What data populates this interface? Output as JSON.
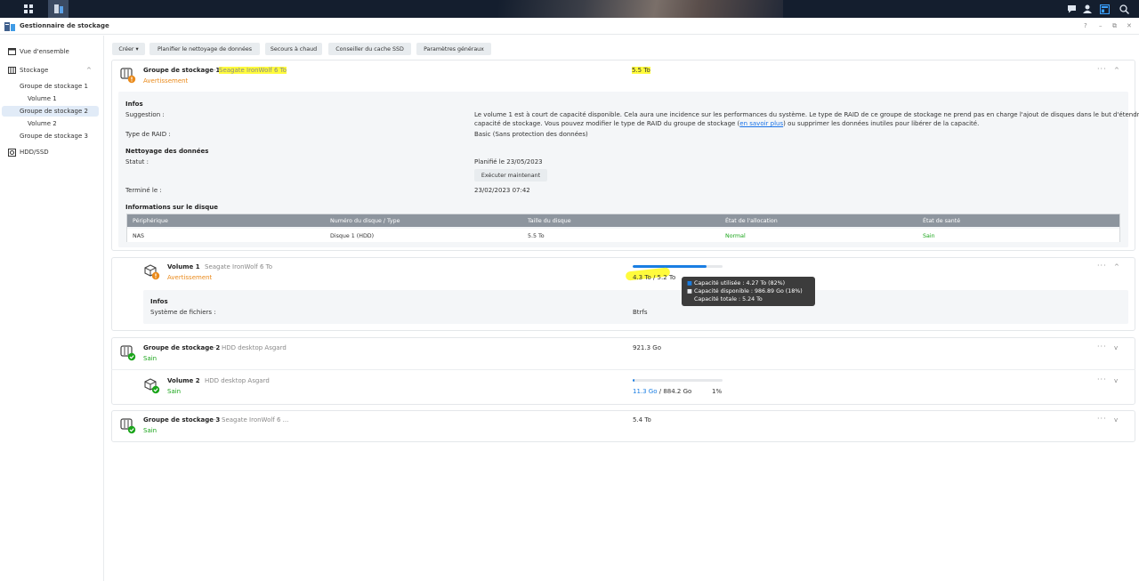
{
  "app": {
    "title": "Gestionnaire de stockage"
  },
  "window": {
    "help": "?",
    "minimize": "–",
    "maximize": "⧉",
    "close": "✕"
  },
  "sidebar": {
    "items": [
      {
        "label": "Vue d'ensemble"
      },
      {
        "label": "Stockage",
        "chevron": "^"
      },
      {
        "label": "Groupe de stockage 1"
      },
      {
        "label": "Volume 1"
      },
      {
        "label": "Groupe de stockage 2"
      },
      {
        "label": "Volume 2"
      },
      {
        "label": "Groupe de stockage 3"
      },
      {
        "label": "HDD/SSD"
      }
    ]
  },
  "toolbar": {
    "create": "Créer ▾",
    "schedule": "Planifier le nettoyage de données",
    "hotspare": "Secours à chaud",
    "ssd": "Conseiller du cache SSD",
    "settings": "Paramètres généraux"
  },
  "pool1": {
    "name": "Groupe de stockage 1",
    "sep": " - ",
    "model": "Seagate IronWolf 6 To",
    "status": "Avertissement",
    "size": "5.5 To",
    "infos_title": "Infos",
    "suggestion_label": "Suggestion :",
    "suggestion_text1": "Le volume 1 est à court de capacité disponible. Cela aura une incidence sur les performances du système. Le type de RAID de ce groupe de stockage ne prend pas en charge l'ajout de disques dans le but d'étendre la",
    "suggestion_text2a": "capacité de stockage. Vous pouvez modifier le type de RAID du groupe de stockage (",
    "suggestion_link": "en savoir plus",
    "suggestion_text2b": ") ou supprimer les données inutiles pour libérer de la capacité.",
    "raid_label": "Type de RAID :",
    "raid_value": "Basic (Sans protection des données)",
    "scrub_title": "Nettoyage des données",
    "scrub_status_label": "Statut :",
    "scrub_status_value": "Planifié le 23/05/2023",
    "run_now": "Exécuter maintenant",
    "finished_label": "Terminé le :",
    "finished_value": "23/02/2023 07:42",
    "disk_title": "Informations sur le disque",
    "table": {
      "headers": [
        "Périphérique",
        "Numéro du disque / Type",
        "Taille du disque",
        "État de l'allocation",
        "État de santé"
      ],
      "row": [
        "NAS",
        "Disque 1 (HDD)",
        "5.5 To",
        "Normal",
        "Sain"
      ]
    }
  },
  "volume1": {
    "name": "Volume 1",
    "sep": " - ",
    "model": "Seagate IronWolf 6 To",
    "status": "Avertissement",
    "usage": "4.3 To / 5.2 To",
    "used_fraction": 0.82,
    "infos_title": "Infos",
    "fs_label": "Système de fichiers :",
    "fs_value": "Btrfs"
  },
  "tooltip": {
    "used": "Capacité utilisée : 4.27 To (82%)",
    "free": "Capacité disponible : 986.89 Go (18%)",
    "total": "Capacité totale : 5.24 To"
  },
  "pool2": {
    "name": "Groupe de stockage 2",
    "sep": " - ",
    "model": "HDD desktop Asgard",
    "status": "Sain",
    "size": "921.3 Go"
  },
  "volume2": {
    "name": "Volume 2",
    "sep": " - ",
    "model": "HDD desktop Asgard",
    "status": "Sain",
    "used": "11.3 Go",
    "total": " / 884.2 Go",
    "percent": "1%",
    "used_fraction": 0.01
  },
  "pool3": {
    "name": "Groupe de stockage 3",
    "sep": " - ",
    "model": "Seagate IronWolf 6 ...",
    "status": "Sain",
    "size": "5.4 To"
  },
  "common": {
    "more": "···",
    "collapse": "^",
    "expand": "v"
  },
  "colors": {
    "accent": "#1a7ee3",
    "warning": "#ea8a1b",
    "healthy": "#1aa51a",
    "highlight": "#fffb3c"
  }
}
